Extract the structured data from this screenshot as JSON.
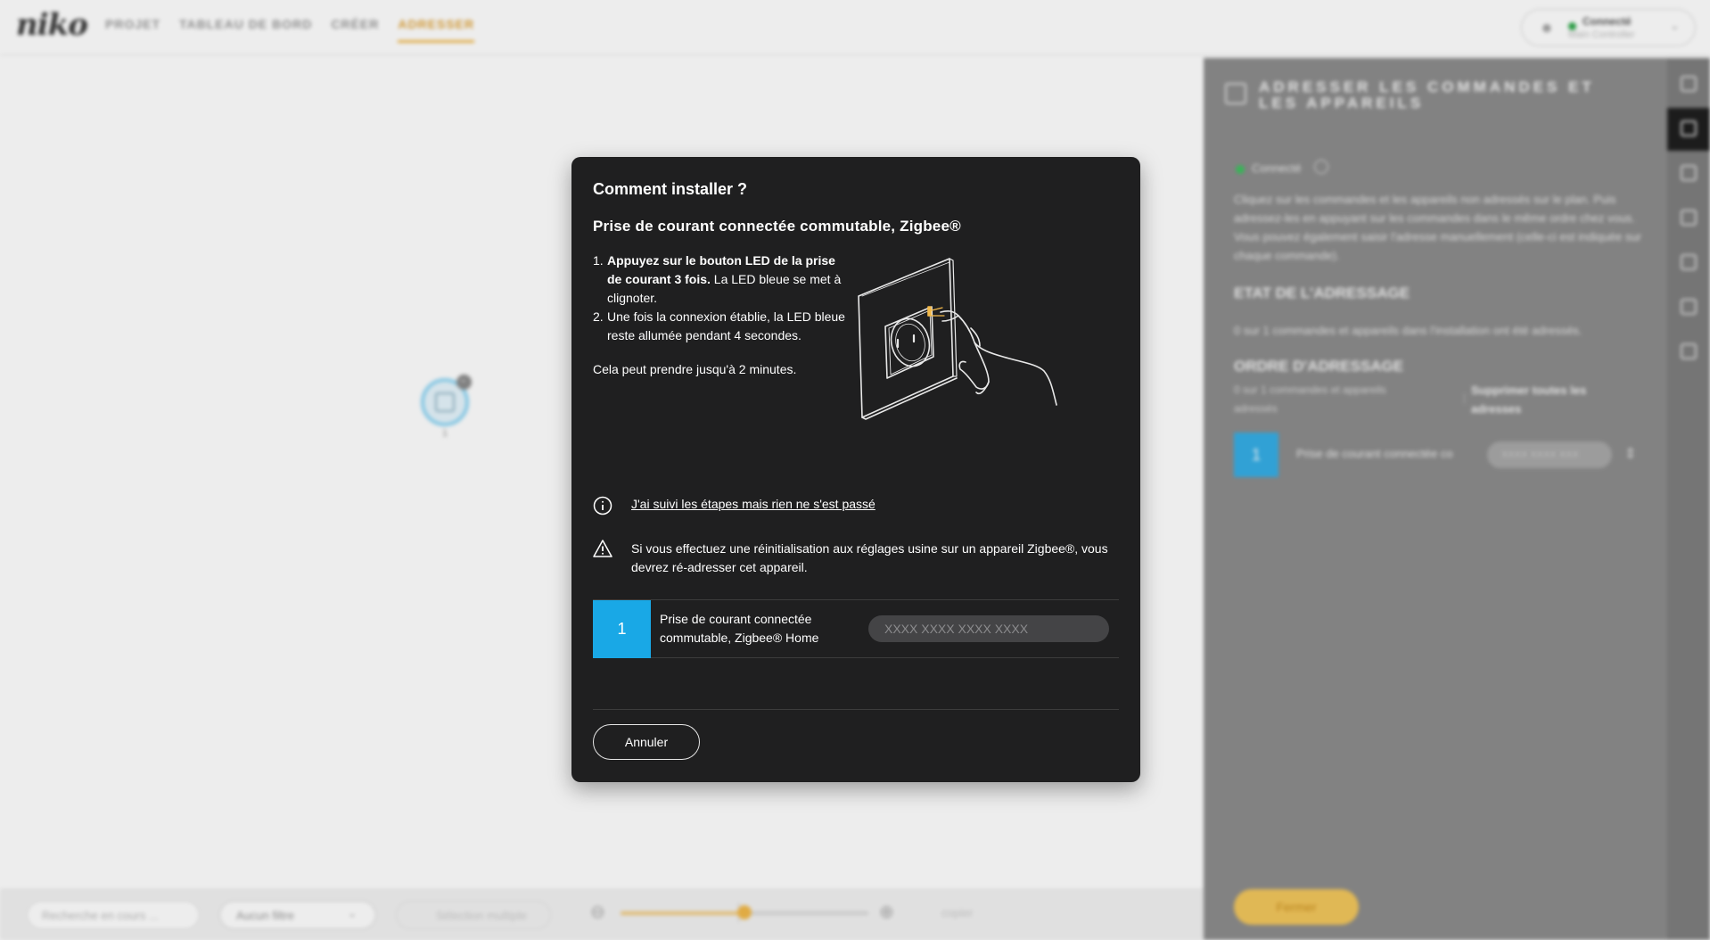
{
  "topbar": {
    "logo": "niko",
    "nav": [
      "PROJET",
      "TABLEAU DE BORD",
      "CRÉER",
      "ADRESSER"
    ],
    "active_nav": "ADRESSER",
    "connection": {
      "status": "Connecté",
      "controller": "Main Controller",
      "status_color": "#2ea84a"
    }
  },
  "canvas": {
    "device_badge": "−",
    "device_number": "1"
  },
  "bottombar": {
    "search_placeholder": "Recherche en cours ...",
    "filter": "Aucun filtre",
    "multi_select": "Sélection multiple",
    "zoom_level": 0.5,
    "copy": "copier"
  },
  "right_panel": {
    "title": "ADRESSER LES COMMANDES ET LES APPAREILS",
    "connected": "Connecté",
    "description": "Cliquez sur les commandes et les appareils non adressés sur le plan. Puis adressez-les en appuyant sur les commandes dans le même ordre chez vous. Vous pouvez également saisir l'adresse manuellement (celle-ci est indiquée sur chaque commande).",
    "state_heading": "ETAT DE L'ADRESSAGE",
    "state_text": "0 sur 1 commandes et appareils dans l'installation ont été adressés.",
    "order_heading": "ORDRE D'ADRESSAGE",
    "order_count": "0 sur 1 commandes et appareils adressés",
    "delete_all": "Supprimer toutes les adresses",
    "row": {
      "number": "1",
      "label": "Prise de courant connectée co...",
      "placeholder": "XXXX XXXX XXX"
    },
    "close": "Fermer"
  },
  "modal": {
    "title": "Comment installer ?",
    "subtitle": "Prise de courant connectée commutable, Zigbee®",
    "steps": [
      {
        "num": "1.",
        "bold": "Appuyez sur le bouton LED de la prise de courant 3 fois.",
        "text": " La LED bleue se met à clignoter."
      },
      {
        "num": "2.",
        "bold": "",
        "text": "Une fois la connexion établie, la LED bleue reste allumée pendant 4 secondes."
      }
    ],
    "note": "Cela peut prendre jusqu'à 2 minutes.",
    "help_link": "J'ai suivi les étapes mais rien ne s'est passé",
    "warning": "Si vous effectuez une réinitialisation aux réglages usine sur un appareil Zigbee®, vous devrez ré-adresser cet appareil.",
    "device_row": {
      "number": "1",
      "label": "Prise de courant connectée commutable, Zigbee® Home",
      "placeholder": "XXXX XXXX XXXX XXXX",
      "number_color": "#19a8e6"
    },
    "cancel": "Annuler"
  }
}
